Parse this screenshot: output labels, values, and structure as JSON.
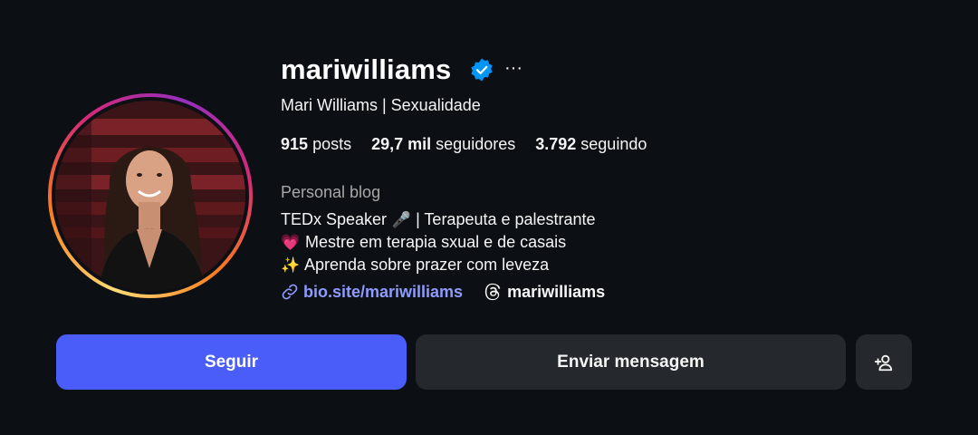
{
  "profile": {
    "username": "mariwilliams",
    "full_name": "Mari Williams | Sexualidade",
    "verified": true,
    "more_label": "···"
  },
  "stats": {
    "posts_count": "915",
    "posts_label": "posts",
    "followers_count": "29,7 mil",
    "followers_label": "seguidores",
    "following_count": "3.792",
    "following_label": "seguindo"
  },
  "bio": {
    "category": "Personal blog",
    "line1_text": "TEDx Speaker",
    "line1_emoji": "🎤",
    "line1_rest": "| Terapeuta e palestrante",
    "line2_emoji": "💗",
    "line2_text": "Mestre em terapia sxual e de casais",
    "line3_emoji": "✨",
    "line3_text": "Aprenda sobre prazer com leveza",
    "link_text": "bio.site/mariwilliams",
    "threads_text": "mariwilliams"
  },
  "buttons": {
    "follow": "Seguir",
    "message": "Enviar mensagem"
  },
  "icons": {
    "verified": "verified-badge-icon",
    "link": "link-icon",
    "threads": "threads-icon",
    "add_person": "add-person-icon"
  },
  "colors": {
    "background": "#0c1014",
    "accent": "#4a5df9",
    "link": "#8e9bff",
    "secondary_button": "#25292e",
    "verified": "#0095f6"
  }
}
